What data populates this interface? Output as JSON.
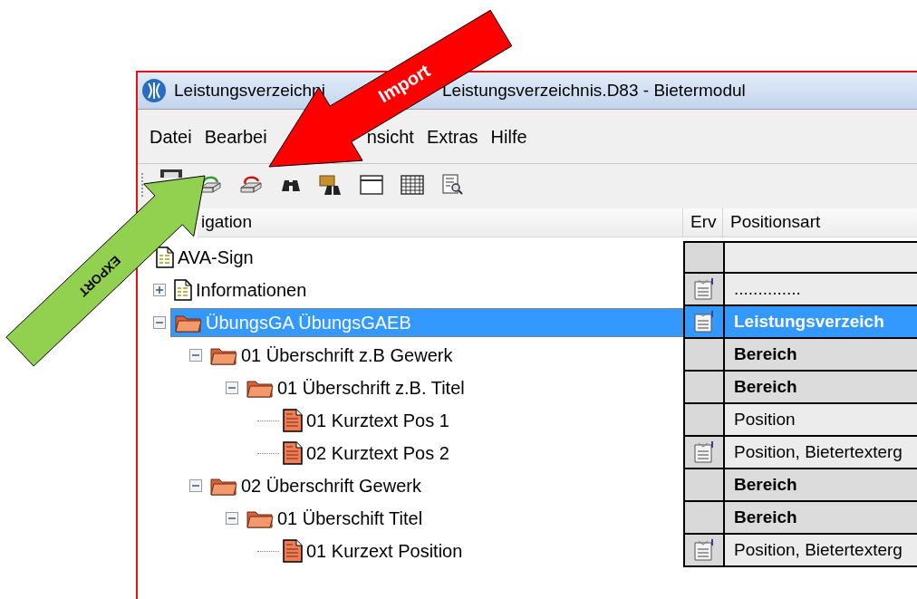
{
  "window": {
    "title_visible": [
      "Leistungsverzeichni",
      "Leistungsverzeichnis.D83 - Bietermodul"
    ]
  },
  "menu": [
    "Datei",
    "Bearbei",
    "nsicht",
    "Extras",
    "Hilfe"
  ],
  "toolbar": [
    {
      "kind": "save"
    },
    {
      "kind": "export"
    },
    {
      "kind": "import"
    },
    {
      "kind": "find"
    },
    {
      "kind": "find-folder"
    },
    {
      "kind": "window"
    },
    {
      "kind": "table"
    },
    {
      "kind": "report"
    }
  ],
  "columns": {
    "navigation": "igation",
    "erw": "Erv",
    "positionsart": "Positionsart"
  },
  "tree": {
    "label": "AVA-Sign",
    "kind": "document",
    "selected": false,
    "note": false,
    "children": [
      {
        "label": "Informationen",
        "kind": "document",
        "expanded": false,
        "selected": false,
        "note": true,
        "positionsart": ".............."
      },
      {
        "label": "ÜbungsGA ÜbungsGAEB",
        "kind": "folder",
        "expanded": true,
        "selected": true,
        "note": true,
        "positionsart": "Leistungsverzeich",
        "children": [
          {
            "label": "01 Überschrift z.B Gewerk",
            "kind": "folder",
            "expanded": true,
            "selected": false,
            "note": false,
            "positionsart": "Bereich",
            "children": [
              {
                "label": "01 Überschrift z.B. Titel",
                "kind": "folder",
                "expanded": true,
                "selected": false,
                "note": false,
                "positionsart": "Bereich",
                "children": [
                  {
                    "label": "01 Kurztext Pos 1",
                    "kind": "position",
                    "selected": false,
                    "note": false,
                    "positionsart": "Position"
                  },
                  {
                    "label": "02 Kurztext Pos 2",
                    "kind": "position",
                    "selected": false,
                    "note": true,
                    "positionsart": "Position, Bietertexterg"
                  }
                ]
              }
            ]
          },
          {
            "label": "02 Überschrift Gewerk",
            "kind": "folder",
            "expanded": true,
            "selected": false,
            "note": false,
            "positionsart": "Bereich",
            "children": [
              {
                "label": "01 Überschift Titel",
                "kind": "folder",
                "expanded": true,
                "selected": false,
                "note": false,
                "positionsart": "Bereich",
                "children": [
                  {
                    "label": "01 Kurzext Position",
                    "kind": "position",
                    "selected": false,
                    "note": true,
                    "positionsart": "Position, Bietertexterg"
                  }
                ]
              }
            ]
          }
        ]
      }
    ]
  },
  "annotations": [
    {
      "label": "Import",
      "color": "#ff0000"
    },
    {
      "label": "EXPORT",
      "color": "#92d050"
    }
  ]
}
